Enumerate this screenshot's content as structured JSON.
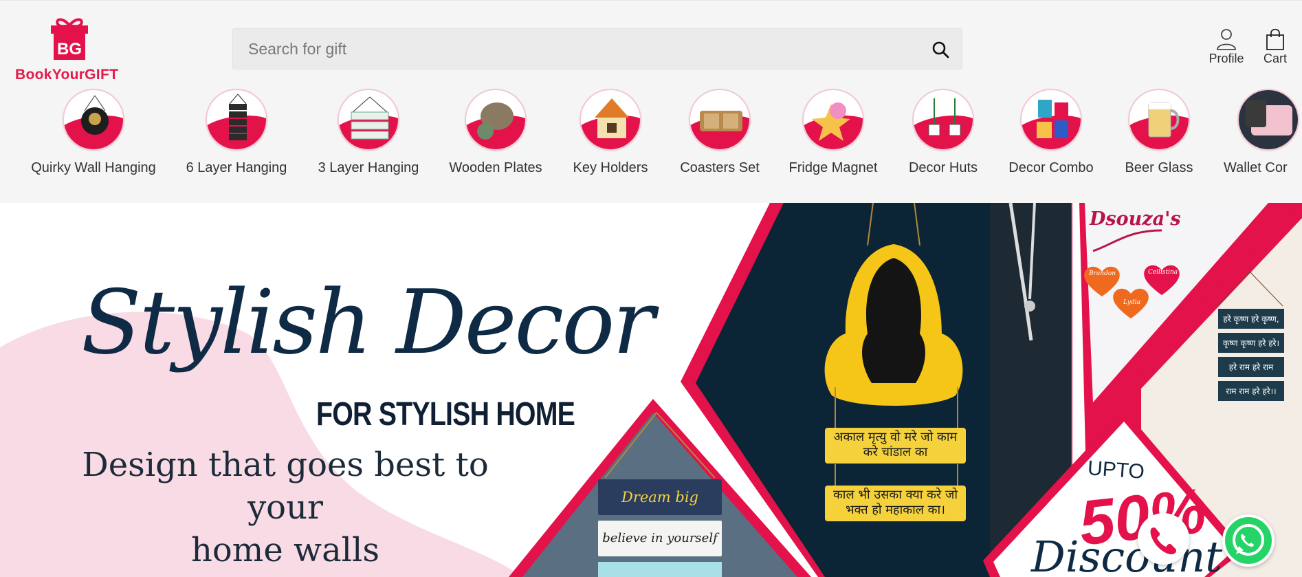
{
  "brand": {
    "logo_text": "BookYourGIFT",
    "logo_mark": "BYG",
    "accent": "#e3124a"
  },
  "search": {
    "placeholder": "Search for gift",
    "value": ""
  },
  "header_actions": [
    {
      "label": "Profile",
      "icon": "person-icon"
    },
    {
      "label": "Cart",
      "icon": "shopping-bag-icon"
    }
  ],
  "categories": [
    {
      "label": "Quirky Wall Hanging",
      "icon": "wall-hanging-icon"
    },
    {
      "label": "6 Layer Hanging",
      "icon": "six-layer-hanging-icon"
    },
    {
      "label": "3 Layer Hanging",
      "icon": "three-layer-hanging-icon"
    },
    {
      "label": "Wooden Plates",
      "icon": "wooden-plate-icon"
    },
    {
      "label": "Key Holders",
      "icon": "key-holder-icon"
    },
    {
      "label": "Coasters Set",
      "icon": "coaster-icon"
    },
    {
      "label": "Fridge Magnet",
      "icon": "fridge-magnet-icon"
    },
    {
      "label": "Decor Huts",
      "icon": "decor-hut-icon"
    },
    {
      "label": "Decor Combo",
      "icon": "decor-combo-icon"
    },
    {
      "label": "Beer Glass",
      "icon": "beer-glass-icon"
    },
    {
      "label": "Wallet Cor",
      "icon": "wallet-icon"
    }
  ],
  "banner": {
    "title": "Stylish Decor",
    "subtitle": "FOR STYLISH HOME",
    "tagline_line1": "Design that goes best to your",
    "tagline_line2": "home walls",
    "name_plate": "Dsouza's",
    "hearts": [
      "Brandon",
      "Cellistina",
      "Lydia"
    ],
    "mahakal_line1": "अकाल मृत्यु वो मरे जो काम",
    "mahakal_line2": "करे चांडाल का",
    "mahakal_line3": "काल भी उसका क्या करे जो",
    "mahakal_line4": "भक्त हो महाकाल का।",
    "shelf_1": "Dream big",
    "shelf_2": "believe in yourself",
    "krishna": [
      "हरे कृष्ण हरे कृष्ण,",
      "कृष्ण कृष्ण हरे हरे।",
      "हरे राम हरे राम",
      "राम राम हरे हरे।।"
    ],
    "offer_upto": "UPTO",
    "offer_value": "50%",
    "offer_text": "Discount"
  },
  "floating": {
    "call": "phone-icon",
    "whatsapp": "whatsapp-icon"
  }
}
